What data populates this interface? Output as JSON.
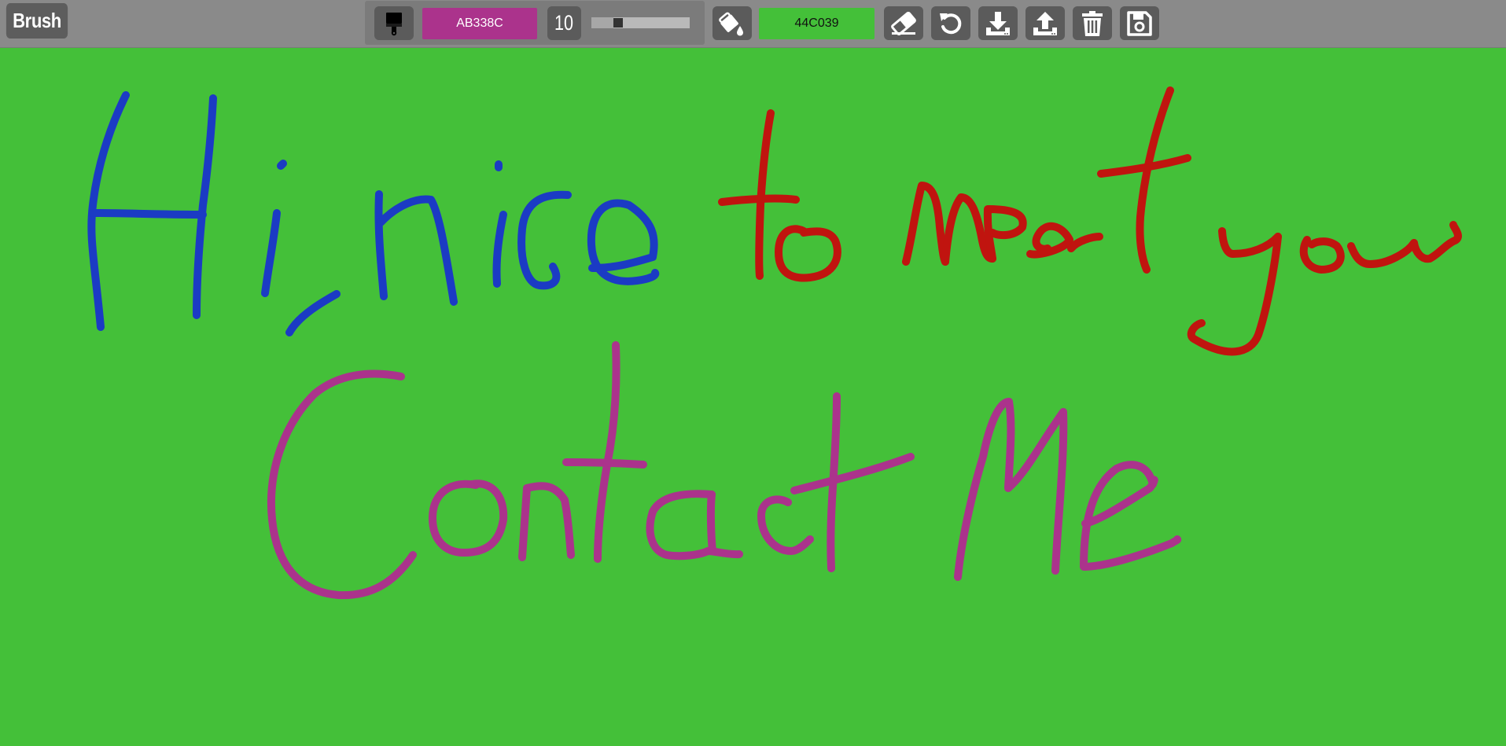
{
  "toolbar": {
    "mode_label": "Brush",
    "brush_color": {
      "hex_label": "AB338C",
      "value": "#AB338C"
    },
    "brush_size": {
      "label": "10",
      "value": 10,
      "min": 1,
      "max": 100
    },
    "fill_color": {
      "hex_label": "44C039",
      "value": "#44C039"
    },
    "tools": [
      {
        "name": "brush-tool-button",
        "icon": "paintbrush-icon"
      },
      {
        "name": "fill-tool-button",
        "icon": "paint-bucket-icon"
      },
      {
        "name": "eraser-button",
        "icon": "eraser-icon"
      },
      {
        "name": "undo-button",
        "icon": "undo-icon"
      },
      {
        "name": "download-button",
        "icon": "download-icon"
      },
      {
        "name": "upload-button",
        "icon": "upload-icon"
      },
      {
        "name": "clear-button",
        "icon": "trash-icon"
      },
      {
        "name": "save-button",
        "icon": "floppy-disk-icon"
      }
    ]
  },
  "canvas": {
    "background": "#44C039",
    "handwriting": [
      {
        "text": "Hi, nice",
        "color": "#1B3BC4"
      },
      {
        "text": "to meet you",
        "color": "#C0140F"
      },
      {
        "text": "Contact Me",
        "color": "#AB338C"
      }
    ]
  }
}
